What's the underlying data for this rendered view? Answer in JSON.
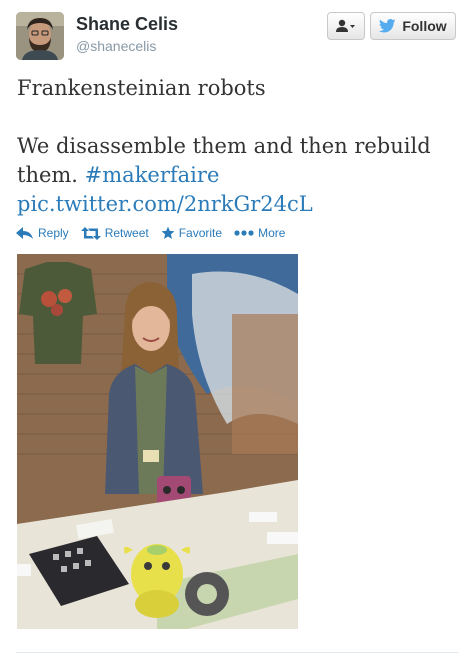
{
  "user": {
    "name": "Shane Celis",
    "handle": "@shanecelis"
  },
  "buttons": {
    "follow_label": "Follow"
  },
  "tweet": {
    "line1": "Frankensteinian robots",
    "line2_text": "We disassemble them and then rebuild them.",
    "hashtag": "#makerfaire",
    "pic_link": "pic.twitter.com/2nrkGr24cL"
  },
  "actions": [
    {
      "label": "Reply",
      "icon": "reply-icon"
    },
    {
      "label": "Retweet",
      "icon": "retweet-icon"
    },
    {
      "label": "Favorite",
      "icon": "star-icon"
    },
    {
      "label": "More",
      "icon": "more-icon"
    }
  ],
  "colors": {
    "link": "#2b7bb9",
    "handle": "#8899a6",
    "twitter_blue": "#55acee"
  }
}
